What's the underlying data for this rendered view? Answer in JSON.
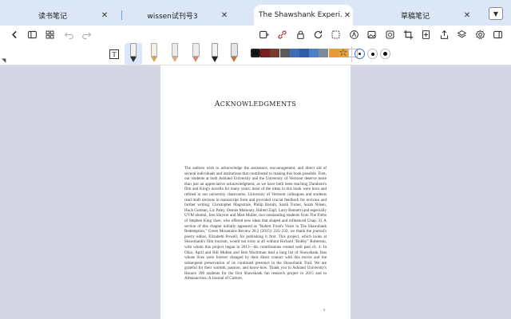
{
  "tabs": [
    {
      "label": "读书笔记",
      "close": "✕",
      "active": false
    },
    {
      "label": "wissen试刊号3",
      "close": "✕",
      "active": false
    },
    {
      "label": "The Shawshank Experi...",
      "close": "✕",
      "active": true
    },
    {
      "label": "草稿笔记",
      "close": "✕",
      "active": false
    }
  ],
  "tab_menu_icon": "▼",
  "toolbar": {
    "left_icons": [
      "back-icon",
      "sidebar-icon",
      "grid-icon",
      "undo-icon",
      "redo-icon"
    ],
    "right_icons": [
      "convert-icon",
      "link-icon",
      "lock-icon",
      "refresh-icon",
      "lasso-icon",
      "pen-mode-icon",
      "image-icon",
      "sticker-icon",
      "crop-icon",
      "add-page-icon",
      "share-icon",
      "layers-icon",
      "settings-icon",
      "panel-icon"
    ]
  },
  "pen_toolbar": {
    "text_tool_label": "T",
    "pens": [
      "fountain-pen",
      "pencil",
      "brush",
      "marker",
      "ballpoint-pen",
      "highlighter"
    ],
    "colors": [
      "#111111",
      "#7a1f1f",
      "#7a3b2e",
      "#5a5a5a",
      "#3e6fb5",
      "#2f5ea8",
      "#4b80c8",
      "#7a8a99",
      "#e89a3a",
      "#e8a23a",
      "#ffffff"
    ],
    "favorite_icon": "☆",
    "stroke_sizes": [
      "small",
      "medium",
      "large"
    ]
  },
  "document": {
    "title_cap_a": "A",
    "title_rest_a": "CKNOWLEDGMENTS",
    "body": "The authors wish to acknowledge the assistance, encouragement, and direct aid of several individuals and institutions that contributed to making this book possible. First, our students at both Ashland University and the University of Vermont deserve more than just an appreciative acknowledgment, as we have both been teaching Darabont's film and King's novella for many years; most of the ideas in this book were born and refined in our university classrooms. University of Vermont colleagues and students read draft sections in manuscript form and provided crucial feedback for revision and further writing: Christopher Magistrale, Philip Baruth, Sarah Turner, Sarah Nilsen, Huck Gutman, Liz Paley, Dennis Mahoney, Hubert Zapf, Larry Bennett (and especially UVM alumni, Jess Slayton and Matt Muller, two outstanding students from The Films of Stephen King class, who offered new ideas that shaped and influenced Chap. 3). A section of this chapter initially appeared as \"Robert Frost's Voice in The Shawshank Redemption,\" Green Mountains Review 28.2 (2015): 225–232; we thank the journal's poetry editor, Elizabeth Powell, for publishing it first. This project, which looks at Shawshank's film tourism, would not exist at all without Richard \"Robby\" Roberson, with whom this project began in 2013—his contributions extend well past ch. 4. In Ohio, April and Bill Mullen and Bob Wachtman lead a long list of Shawshank fans whose lives were forever changed by their direct contact with this movie and the subsequent preservation of its continued presence in the Shawshank Trail. We are grateful for their warmth, passion, and know-how. Thank you to Ashland University's Honors 390 students for the first Shawshank fan research project in 2015 and to Almanacritus: A Journal of Culture,",
    "page_number": "v"
  }
}
